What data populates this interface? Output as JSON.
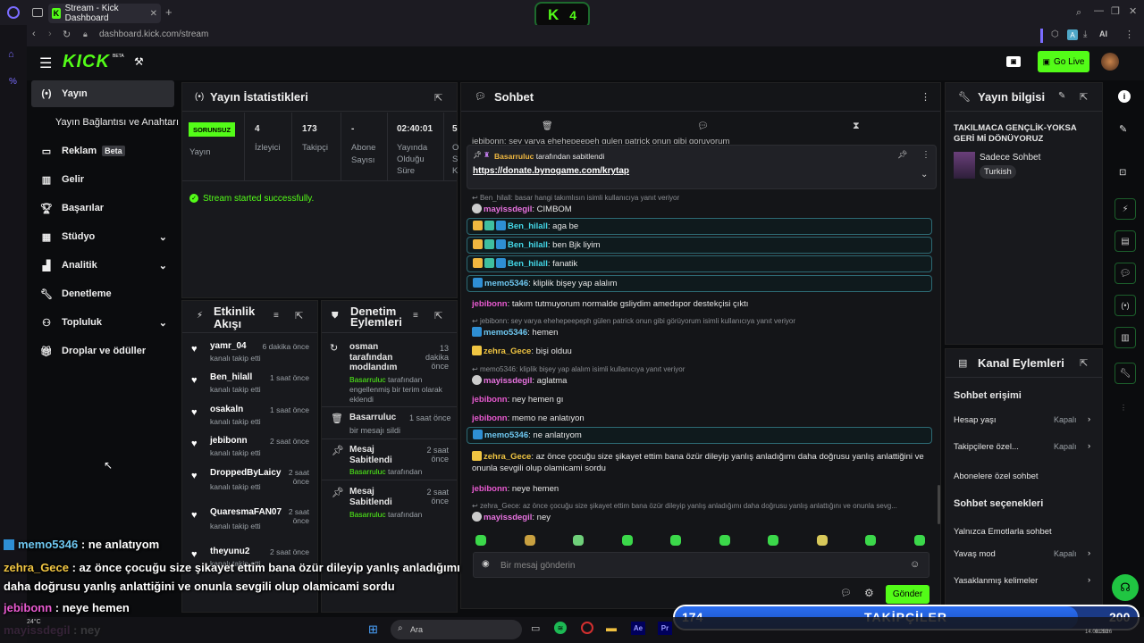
{
  "browser": {
    "tab_title": "Stream - Kick Dashboard",
    "url": "dashboard.kick.com/stream",
    "kick_logo": "K",
    "counter": "4",
    "ai_label": "AI"
  },
  "app": {
    "logo": "KICK",
    "logo_beta": "BETA",
    "go_live": "Go Live"
  },
  "sidebar": {
    "items": [
      {
        "label": "Yayın",
        "icon": "broadcast-icon"
      },
      {
        "label": "Yayın Bağlantısı ve Anahtarı"
      },
      {
        "label": "Reklam",
        "badge": "Beta",
        "icon": "ad-icon"
      },
      {
        "label": "Gelir",
        "icon": "chart-icon"
      },
      {
        "label": "Başarılar",
        "icon": "trophy-icon"
      },
      {
        "label": "Stüdyo",
        "icon": "studio-icon"
      },
      {
        "label": "Analitik",
        "icon": "analytics-icon"
      },
      {
        "label": "Denetleme",
        "icon": "wrench-icon"
      },
      {
        "label": "Topluluk",
        "icon": "community-icon"
      },
      {
        "label": "Droplar ve ödüller",
        "icon": "gift-icon"
      }
    ]
  },
  "stats": {
    "title": "Yayın İstatistikleri",
    "status": "SORUNSUZ",
    "status_label": "Yayın",
    "viewers": "4",
    "viewers_label": "İzleyici",
    "followers": "173",
    "followers_label": "Takipçi",
    "subs": "-",
    "subs_label1": "Abone",
    "subs_label2": "Sayısı",
    "duration": "02:40:01",
    "duration_label1": "Yayında",
    "duration_label2": "Olduğu",
    "duration_label3": "Süre",
    "extra": "5",
    "extra_l1": "O",
    "extra_l2": "S",
    "extra_l3": "K",
    "success": "Stream started successfully."
  },
  "activity": {
    "title1": "Etkinlik",
    "title2": "Akışı",
    "items": [
      {
        "name": "yamr_04",
        "desc": "kanalı takip etti",
        "time": "6 dakika önce"
      },
      {
        "name": "Ben_hilall",
        "desc": "kanalı takip etti",
        "time": "1 saat önce"
      },
      {
        "name": "osakaln",
        "desc": "kanalı takip etti",
        "time": "1 saat önce"
      },
      {
        "name": "jebibonn",
        "desc": "kanalı takip etti",
        "time": "2 saat önce"
      },
      {
        "name": "DroppedByLaicy",
        "desc": "kanalı takip etti",
        "time1": "2 saat",
        "time2": "önce"
      },
      {
        "name": "QuaresmaFAN07",
        "desc": "kanalı takip etti",
        "time1": "2 saat",
        "time2": "önce"
      },
      {
        "name": "theyunu2",
        "desc": "kanalı takip etti",
        "time": "2 saat önce"
      }
    ]
  },
  "moderation": {
    "title1": "Denetim",
    "title2": "Eylemleri",
    "items": [
      {
        "l1": "osman",
        "l2": "tarafından",
        "l3": "modlandım",
        "t1": "13",
        "t2": "dakika",
        "t3": "önce",
        "by": "Basarruluc",
        "d1": "tarafından",
        "d2": "engellenmiş bir terim olarak",
        "d3": "eklendi"
      },
      {
        "l1": "Basarruluc",
        "t": "1 saat önce",
        "desc": "bir mesajı sildi"
      },
      {
        "l1": "Mesaj",
        "l2": "Sabitlendi",
        "t1": "2 saat",
        "t2": "önce",
        "by": "Basarruluc",
        "d": "tarafından"
      },
      {
        "l1": "Mesaj",
        "l2": "Sabitlendi",
        "t1": "2 saat",
        "t2": "önce",
        "by": "Basarruluc",
        "d": "tarafından"
      }
    ]
  },
  "chat": {
    "title": "Sohbet",
    "pinned_by": "Basarruluc",
    "pinned_suffix": "tarafından sabitlendi",
    "pinned_link": "https://donate.bynogame.com/krytap",
    "top_cut": "jebibonn: sey varya ehehepeepeh gulen patrick onun gibi goruyorum",
    "messages": [
      {
        "reply": "Ben_hilall: basar hangi takımlısın isimli kullanıcıya yanıt veriyor",
        "user": "mayissdegil",
        "text": "CIMBOM",
        "color": "#e873e0",
        "badge": "disc"
      },
      {
        "user": "Ben_hilall",
        "text": "aga be",
        "color": "#44d8e8",
        "hl": true,
        "badge": "multi"
      },
      {
        "user": "Ben_hilall",
        "text": "ben Bjk liyim",
        "color": "#44d8e8",
        "hl": true,
        "badge": "multi"
      },
      {
        "user": "Ben_hilall",
        "text": "fanatik",
        "color": "#44d8e8",
        "hl": true,
        "badge": "multi"
      },
      {
        "user": "memo5346",
        "text": "kliplik bişey yap alalım",
        "color": "#6ec7f0",
        "hl": true,
        "badge": "arrow"
      },
      {
        "user": "jebibonn",
        "text": "takım tutmuyorum normalde gsliydim amedspor destekçisi çıktı",
        "color": "#e85ad0"
      },
      {
        "reply": "jebibonn: sey varya ehehepeepeph gülen patrick onun gibi görüyorum isimli kullanıcıya yanıt veriyor",
        "user": "memo5346",
        "text": "hemen",
        "color": "#6ec7f0",
        "badge": "arrow"
      },
      {
        "user": "zehra_Gece",
        "text": "bişi olduu",
        "color": "#f0c542",
        "badge": "sixteen"
      },
      {
        "reply": "memo5346: kliplik bişey yap alalım isimli kullanıcıya yanıt veriyor",
        "user": "mayissdegil",
        "text": "aglatma",
        "color": "#e873e0",
        "badge": "disc"
      },
      {
        "user": "jebibonn",
        "text": "ney hemen gı",
        "color": "#e85ad0"
      },
      {
        "user": "jebibonn",
        "text": "memo ne anlatıyon",
        "color": "#e85ad0"
      },
      {
        "user": "memo5346",
        "text": "ne anlatıyom",
        "color": "#6ec7f0",
        "hl": true,
        "badge": "arrow"
      },
      {
        "user": "zehra_Gece",
        "text": "az önce çocuğu size şikayet ettim bana özür dileyip yanlış anladığımı daha doğrusu yanlış anlattiğini ve onunla sevgili olup olamicami sordu",
        "color": "#f0c542",
        "badge": "sixteen"
      },
      {
        "user": "jebibonn",
        "text": "neye hemen",
        "color": "#e85ad0"
      },
      {
        "reply": "zehra_Gece: az önce çocuğu size şikayet ettim bana özür dileyip yanlış anladığımı daha doğrusu yanlış anlattığını ve onunla sevg...",
        "user": "mayissdegil",
        "text": "ney",
        "color": "#e873e0",
        "badge": "disc"
      }
    ],
    "input_placeholder": "Bir mesaj gönderin",
    "send": "Gönder"
  },
  "stream_info": {
    "title": "Yayın bilgisi",
    "stream_title": "TAKILMACA GENÇLİK-YOKSA GERİ Mİ DÖNÜYORUZ",
    "category": "Sadece Sohbet",
    "language": "Turkish"
  },
  "channel_actions": {
    "title": "Kanal Eylemleri",
    "chat_access": "Sohbet erişimi",
    "account_age": "Hesap yaşı",
    "account_age_val": "Kapalı",
    "followers_only": "Takipçilere özel...",
    "followers_only_val": "Kapalı",
    "subs_only": "Abonelere özel sohbet",
    "chat_options": "Sohbet seçenekleri",
    "emote_only": "Yalnızca Emotlarla sohbet",
    "slow_mode": "Yavaş mod",
    "slow_mode_val": "Kapalı",
    "banned_words": "Yasaklanmış kelimeler"
  },
  "overlay": {
    "lines": [
      {
        "user": "memo5346",
        "text": " : ne anlatıyom",
        "color": "#6ec7f0"
      },
      {
        "user": "zehra_Gece",
        "text": " : az önce çocuğu size şikayet ettim bana özür dileyip yanlış anladığımı",
        "color": "#f0c542"
      },
      {
        "user": "",
        "text": "daha doğrusu yanlış anlattiğini ve onunla sevgili olup olamicami sordu",
        "color": "#fff"
      },
      {
        "user": "jebibonn",
        "text": " : neye hemen",
        "color": "#e85ad0"
      },
      {
        "user": "mayissdegil",
        "text": " : ney",
        "color": "#e873e0"
      }
    ],
    "follower_current": "174",
    "follower_label": "TAKİPÇİLER",
    "follower_goal": "200",
    "follower_progress": 0.87
  },
  "taskbar": {
    "temp": "24°C",
    "search": "Ara",
    "apps": [
      "Ae",
      "Pr"
    ],
    "clock_time": "01:53",
    "clock_date": "14.08.2026"
  }
}
